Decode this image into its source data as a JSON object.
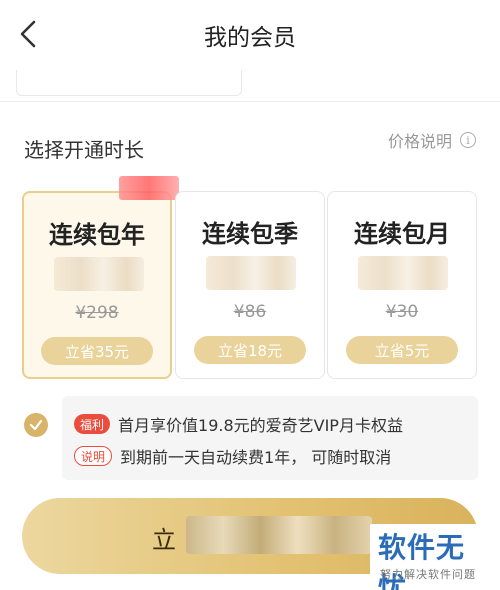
{
  "nav": {
    "title": "我的会员",
    "back_icon": "chevron-left-icon"
  },
  "section": {
    "title": "选择开通时长",
    "price_help": "价格说明",
    "info_icon": "i"
  },
  "plans": [
    {
      "name": "连续包年",
      "original_price": "¥298",
      "save": "立省35元",
      "selected": true
    },
    {
      "name": "连续包季",
      "original_price": "¥86",
      "save": "立省18元",
      "selected": false
    },
    {
      "name": "连续包月",
      "original_price": "¥30",
      "save": "立省5元",
      "selected": false
    }
  ],
  "benefits": {
    "tag_fuli": "福利",
    "text_fuli": "首月享价值19.8元的爱奇艺VIP月卡权益",
    "tag_shuoming": "说明",
    "text_shuoming": "到期前一天自动续费1年， 可随时取消"
  },
  "cta": {
    "label": "立"
  },
  "watermark": {
    "main": "软件无忧",
    "sub": "努力解决软件问题"
  },
  "colors": {
    "gold": "#e2c170",
    "accent_red": "#ea4d3d",
    "selected_bg": "#fdf8ea"
  }
}
